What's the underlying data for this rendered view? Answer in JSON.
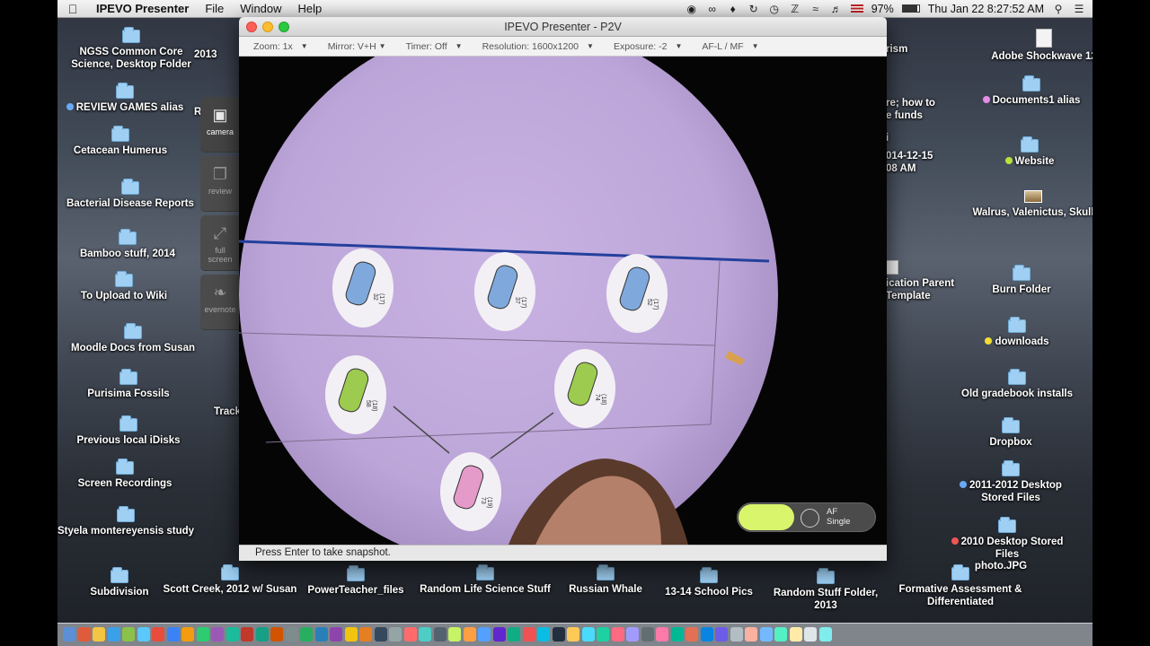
{
  "menubar": {
    "app_name": "IPEVO Presenter",
    "menus": [
      "File",
      "Window",
      "Help"
    ],
    "battery": "97%",
    "clock": "Thu Jan 22  8:27:52 AM"
  },
  "desktop": {
    "left_items": [
      {
        "label": "NGSS Common Core Science, Desktop Folder",
        "kind": "folder"
      },
      {
        "label": "REVIEW GAMES alias",
        "kind": "folder",
        "dot": "#6aa9f5"
      },
      {
        "label": "Cetacean Humerus",
        "kind": "folder"
      },
      {
        "label": "Bacterial Disease Reports",
        "kind": "folder"
      },
      {
        "label": "Bamboo stuff, 2014",
        "kind": "folder"
      },
      {
        "label": "To Upload to Wiki",
        "kind": "folder"
      },
      {
        "label": "Moodle Docs from Susan",
        "kind": "folder"
      },
      {
        "label": "Purisima Fossils",
        "kind": "folder"
      },
      {
        "label": "Previous local iDisks",
        "kind": "folder"
      },
      {
        "label": "Screen Recordings",
        "kind": "folder"
      },
      {
        "label": "Styela montereyensis study",
        "kind": "folder"
      },
      {
        "label": "Subdivision",
        "kind": "folder"
      }
    ],
    "bottom_items": [
      {
        "label": "Scott Creek, 2012 w/ Susan",
        "kind": "folder"
      },
      {
        "label": "PowerTeacher_files",
        "kind": "folder"
      },
      {
        "label": "Random Life Science Stuff",
        "kind": "folder"
      },
      {
        "label": "Russian Whale",
        "kind": "folder"
      },
      {
        "label": "13-14 School Pics",
        "kind": "folder"
      },
      {
        "label": "Random Stuff Folder, 2013",
        "kind": "folder"
      },
      {
        "label": "Formative Assessment & Differentiated",
        "kind": "folder"
      }
    ],
    "right_items": [
      {
        "label": "Adobe Shockwave 12",
        "kind": "doc"
      },
      {
        "label": "Documents1 alias",
        "kind": "folder",
        "dot": "#e58de9"
      },
      {
        "label": "Website",
        "kind": "folder",
        "dot": "#b9e23a"
      },
      {
        "label": "Walrus, Valenictus, Skull",
        "kind": "image"
      },
      {
        "label": "Burn Folder",
        "kind": "folder"
      },
      {
        "label": "downloads",
        "kind": "folder",
        "dot": "#f1dd33"
      },
      {
        "label": "Old gradebook installs",
        "kind": "folder"
      },
      {
        "label": "Dropbox",
        "kind": "folder"
      },
      {
        "label": "2011-2012 Desktop Stored Files",
        "kind": "folder",
        "dot": "#6aa9f5"
      },
      {
        "label": "2010 Desktop Stored Files",
        "kind": "folder",
        "dot": "#f05555"
      },
      {
        "label": "photo.JPG",
        "kind": "image"
      }
    ],
    "partial_labels": {
      "p2013": "2013",
      "pR": "R",
      "track": "Track",
      "rism": "rism",
      "re_how": "re; how to",
      "funds": "e funds",
      "i": "i",
      "date1": "014-12-15",
      "time1": "08 AM",
      "parent": "ication Parent",
      "template": "Template"
    }
  },
  "window": {
    "title": "IPEVO Presenter - P2V",
    "toolbar": {
      "zoom": "Zoom: 1x",
      "mirror": "Mirror: V+H",
      "timer": "Timer: Off",
      "resolution": "Resolution: 1600x1200",
      "exposure": "Exposure: -2",
      "af": "AF-L / MF"
    },
    "status": "Press Enter to take snapshot.",
    "side_panel": {
      "camera": "camera",
      "review": "review",
      "fullscreen_1": "full",
      "fullscreen_2": "screen",
      "evernote": "evernote"
    },
    "af_control": {
      "line1": "AF",
      "line2": "Single"
    }
  },
  "camera_feed": {
    "cards": [
      {
        "num": "32",
        "sub": "(17)",
        "color": "#7fa9dc"
      },
      {
        "num": "37",
        "sub": "(17)",
        "color": "#7fa9dc"
      },
      {
        "num": "52",
        "sub": "(17)",
        "color": "#7fa9dc"
      },
      {
        "num": "58",
        "sub": "(18)",
        "color": "#9ccb4f"
      },
      {
        "num": "74",
        "sub": "(18)",
        "color": "#9ccb4f"
      },
      {
        "num": "73",
        "sub": "(19)",
        "color": "#e49bc9"
      }
    ]
  }
}
